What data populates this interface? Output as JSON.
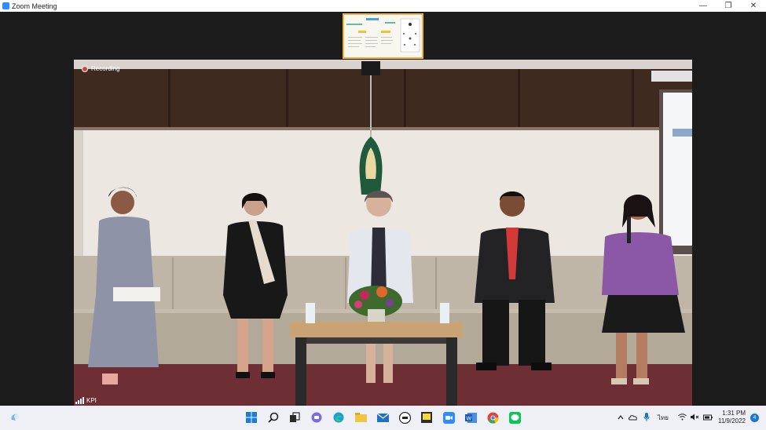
{
  "window": {
    "title": "Zoom Meeting",
    "minimize": "—",
    "maximize": "❐",
    "close": "✕"
  },
  "video": {
    "recording_label": "Recording",
    "participant_name": "KPI"
  },
  "tray": {
    "language": "ไทย"
  },
  "clock": {
    "time": "1:31 PM",
    "date": "11/9/2022"
  },
  "notifications": {
    "count": "4"
  },
  "icons": [
    "widgets-icon",
    "start-icon",
    "search-icon",
    "task-view-icon",
    "chat-icon",
    "edge-icon",
    "file-explorer-icon",
    "mail-icon",
    "dell-icon",
    "sticky-notes-icon",
    "zoom-icon",
    "word-icon",
    "chrome-icon",
    "line-icon"
  ],
  "colors": {
    "accent": "#2d8cff",
    "thumbnail_border": "#f2b43a",
    "recording": "#e23b3b"
  }
}
